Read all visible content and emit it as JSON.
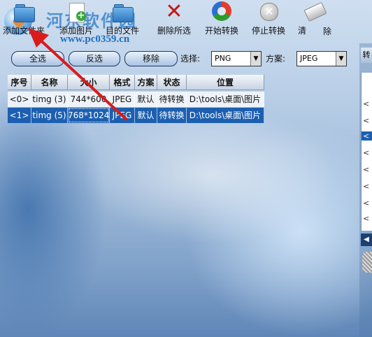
{
  "toolbar": {
    "items": [
      {
        "label": "添加文件夹",
        "icon": "folder-icon"
      },
      {
        "label": "添加图片",
        "icon": "image-add-icon"
      },
      {
        "label": "目的文件",
        "icon": "target-folder-icon"
      },
      {
        "label": "删除所选",
        "icon": "delete-x-icon"
      },
      {
        "label": "开始转换",
        "icon": "recycle-icon"
      },
      {
        "label": "停止转换",
        "icon": "stop-icon"
      },
      {
        "label": "清",
        "icon": "eraser-icon"
      },
      {
        "label": "除",
        "icon": ""
      }
    ]
  },
  "watermark": {
    "title": "河东软件园",
    "url": "www.pc0359.cn"
  },
  "controls": {
    "select_all": "全选",
    "invert": "反选",
    "remove": "移除",
    "select_label": "选择:",
    "select_value": "PNG",
    "scheme_label": "方案:",
    "scheme_value": "JPEG"
  },
  "table": {
    "headers": [
      "序号",
      "名称",
      "大小",
      "格式",
      "方案",
      "状态",
      "位置"
    ],
    "rows": [
      {
        "index": "<0>",
        "name": "timg (3)",
        "size": "744*600",
        "format": "JPEG",
        "scheme": "默认",
        "status": "待转换",
        "location": "D:\\tools\\桌面\\图片"
      },
      {
        "index": "<1>",
        "name": "timg (5)",
        "size": "768*1024",
        "format": "JPEG",
        "scheme": "默认",
        "status": "待转换",
        "location": "D:\\tools\\桌面\\图片"
      }
    ]
  },
  "right_panel": {
    "header": "转",
    "items": [
      "<",
      "<",
      "<",
      "<",
      "<",
      "<",
      "<",
      "<",
      "<"
    ],
    "scroll_arrow": "◀"
  },
  "colors": {
    "selection": "#1c5fb0",
    "arrow": "#d81c1c"
  }
}
